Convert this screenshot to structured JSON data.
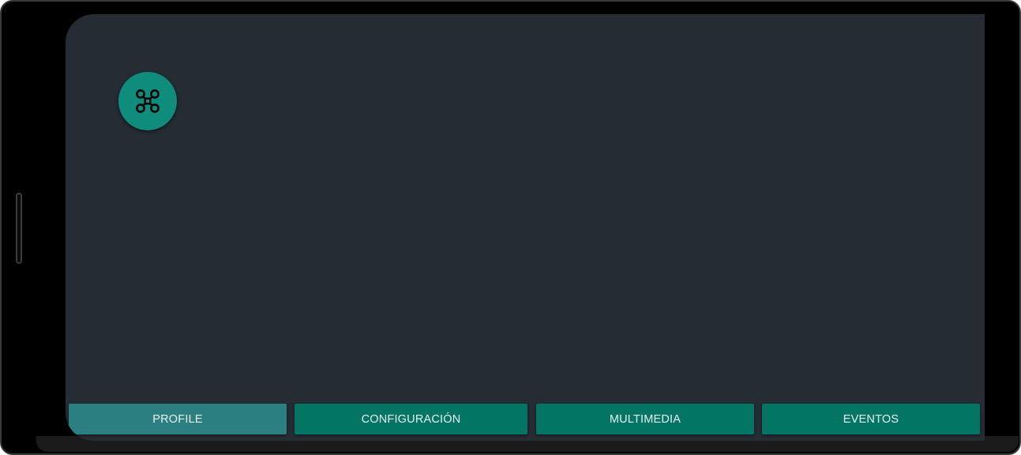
{
  "app": {
    "fab_icon": "drone-icon"
  },
  "colors": {
    "screen_background": "#252c34",
    "fab": "#0f8c7c",
    "tab_default": "#027564",
    "tab_active": "#2b7f80",
    "tab_text": "#e6f2f0"
  },
  "tabs": {
    "profile": {
      "label": "PROFILE",
      "active": true
    },
    "configuracion": {
      "label": "CONFIGURACIÓN",
      "active": false
    },
    "multimedia": {
      "label": "MULTIMEDIA",
      "active": false
    },
    "eventos": {
      "label": "EVENTOS",
      "active": false
    }
  }
}
